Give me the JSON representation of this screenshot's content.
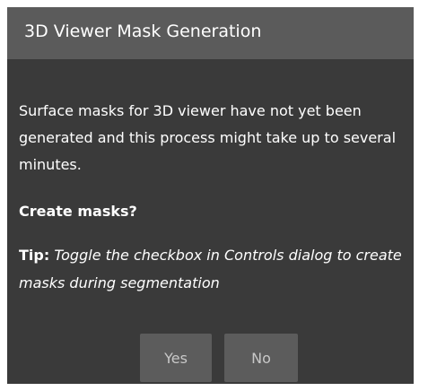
{
  "dialog": {
    "title": "3D Viewer Mask Generation",
    "message": "Surface masks for 3D viewer have not yet been generated and this process might take up to several minutes.",
    "question": "Create masks?",
    "tip_label": "Tip:",
    "tip_text": "Toggle the checkbox in Controls dialog to create masks during segmentation",
    "buttons": {
      "yes_label": "Yes",
      "no_label": "No"
    }
  },
  "colors": {
    "dialog_background": "#3a3a3a",
    "title_bar_background": "#5b5b5b",
    "button_background": "#5c5c5c",
    "text": "#ffffff",
    "button_text": "#c8c8c8"
  }
}
